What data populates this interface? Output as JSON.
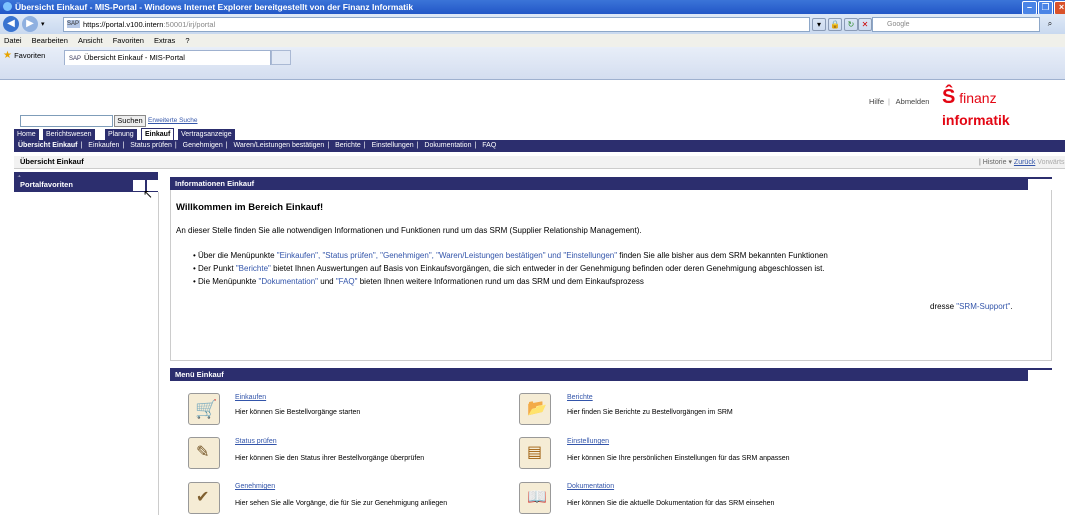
{
  "window": {
    "title": "Übersicht Einkauf - MIS-Portal - Windows Internet Explorer bereitgestellt von der Finanz Informatik"
  },
  "address": {
    "url": "https://portal.v100.intern",
    "url_rest": ":50001/irj/portal",
    "search_placeholder": "Google"
  },
  "menu": [
    "Datei",
    "Bearbeiten",
    "Ansicht",
    "Favoriten",
    "Extras",
    "?"
  ],
  "favorites": {
    "label": "Favoriten",
    "tab": "Übersicht Einkauf - MIS-Portal"
  },
  "header": {
    "links": [
      "Hilfe",
      "Abmelden"
    ],
    "logo_prefix": "finanz",
    "logo_suffix": "informatik"
  },
  "search": {
    "button": "Suchen",
    "advanced": "Erweiterte Suche"
  },
  "topnav": [
    "Home",
    "Berichtswesen",
    "Planung",
    "Einkauf",
    "Vertragsanzeige"
  ],
  "subnav": [
    "Übersicht Einkauf",
    "Einkaufen",
    "Status prüfen",
    "Genehmigen",
    "Waren/Leistungen bestätigen",
    "Berichte",
    "Einstellungen",
    "Dokumentation",
    "FAQ"
  ],
  "page": {
    "title": "Übersicht Einkauf",
    "history": "Historie",
    "back": "Zurück",
    "forward": "Vorwärts"
  },
  "left": {
    "title": "Portalfavoriten"
  },
  "info": {
    "title": "Informationen Einkauf",
    "welcome": "Willkommen im Bereich Einkauf!",
    "intro": "An dieser Stelle finden Sie alle notwendigen Informationen und Funktionen rund um das SRM (Supplier Relationship Management).",
    "b1_pre": "Über die Menüpunkte ",
    "b1_q": "\"Einkaufen\", \"Status prüfen\", \"Genehmigen\", \"Waren/Leistungen bestätigen\" und \"Einstellungen\"",
    "b1_post": " finden Sie alle bisher aus dem SRM bekannten Funktionen",
    "b2_pre": "Der Punkt ",
    "b2_q": "\"Berichte\"",
    "b2_post": " bietet Ihnen Auswertungen auf Basis von Einkaufsvorgängen, die sich entweder in der Genehmigung befinden oder deren Genehmigung abgeschlossen ist.",
    "b3_pre": "Die Menüpunkte ",
    "b3_q1": "\"Dokumentation\"",
    "b3_mid": " und ",
    "b3_q2": "\"FAQ\"",
    "b3_post": " bieten Ihnen weitere Informationen rund um das SRM und dem Einkaufsprozess",
    "support_pre": "dresse ",
    "support_q": "\"SRM-Support\"",
    "support_post": "."
  },
  "menu_panel": {
    "title": "Menü Einkauf",
    "items": [
      {
        "title": "Einkaufen",
        "desc": "Hier können Sie Bestellvorgänge starten"
      },
      {
        "title": "Berichte",
        "desc": "Hier finden Sie Berichte zu Bestellvorgängen im SRM"
      },
      {
        "title": "Status prüfen",
        "desc": "Hier können Sie den Status ihrer Bestellvorgänge überprüfen"
      },
      {
        "title": "Einstellungen",
        "desc": "Hier können Sie Ihre persönlichen Einstellungen für das SRM anpassen"
      },
      {
        "title": "Genehmigen",
        "desc": "Hier sehen Sie alle Vorgänge, die für Sie zur Genehmigung anliegen"
      },
      {
        "title": "Dokumentation",
        "desc": "Hier können Sie die aktuelle Dokumentation für das SRM einsehen"
      }
    ]
  }
}
